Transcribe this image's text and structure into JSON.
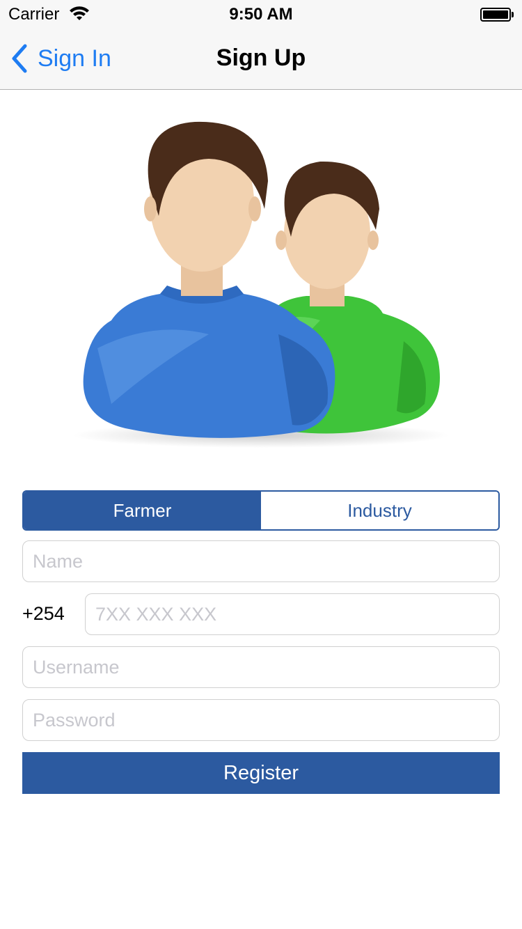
{
  "status_bar": {
    "carrier": "Carrier",
    "time": "9:50 AM",
    "icons": [
      "wifi-icon",
      "battery-icon"
    ]
  },
  "nav_bar": {
    "back_label": "Sign In",
    "back_icon": "chevron-left-icon",
    "title": "Sign Up",
    "accent_color": "#1e7cf2"
  },
  "illustration": {
    "icon": "users-icon",
    "colors": {
      "front_shirt": "#3a7bd5",
      "back_shirt": "#3fc43a",
      "hair": "#4a2c1a",
      "skin": "#f2d2b0"
    }
  },
  "segment": {
    "options": [
      "Farmer",
      "Industry"
    ],
    "selected": "Farmer",
    "color": "#2c5aa0"
  },
  "form": {
    "name": {
      "placeholder": "Name",
      "value": ""
    },
    "phone_prefix": "+254",
    "phone": {
      "placeholder": "7XX XXX XXX",
      "value": ""
    },
    "username": {
      "placeholder": "Username",
      "value": ""
    },
    "password": {
      "placeholder": "Password",
      "value": ""
    }
  },
  "register_button": {
    "label": "Register",
    "color": "#2c5aa0"
  }
}
